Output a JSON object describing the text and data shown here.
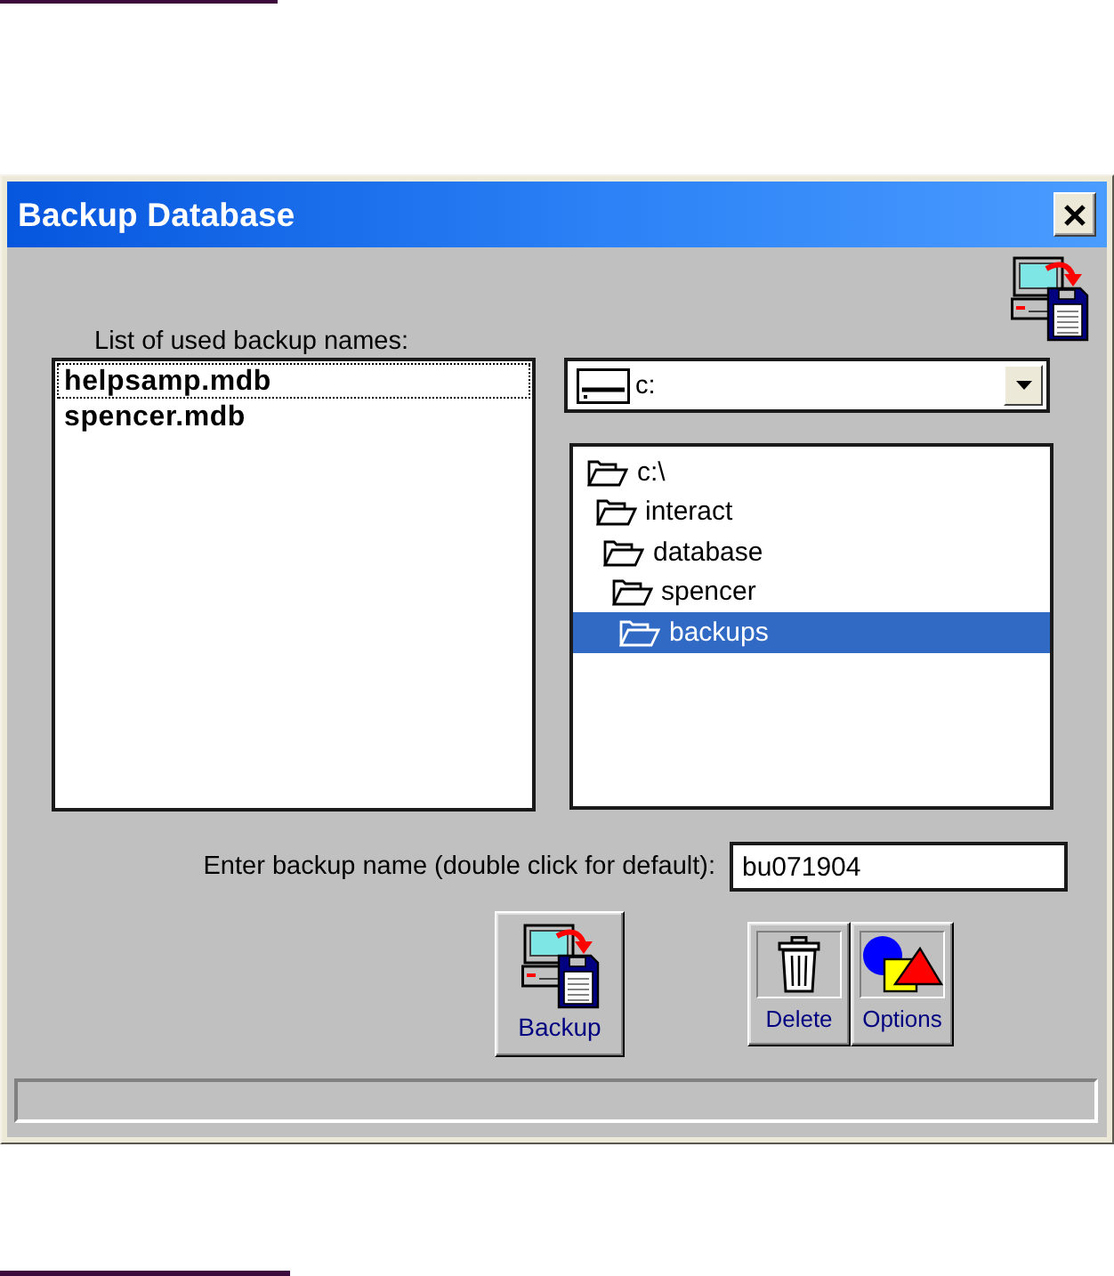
{
  "dialog": {
    "title": "Backup Database"
  },
  "used_names": {
    "label": "List of used backup names:",
    "items": [
      {
        "name": "helpsamp.mdb",
        "focused": true
      },
      {
        "name": "spencer.mdb",
        "focused": false
      }
    ]
  },
  "drive": {
    "value": "c:"
  },
  "folders": [
    {
      "name": "c:\\",
      "selected": false,
      "children": [
        {
          "name": "interact",
          "selected": false,
          "children": [
            {
              "name": "database",
              "selected": false,
              "children": [
                {
                  "name": "spencer",
                  "selected": false,
                  "children": [
                    {
                      "name": "backups",
                      "selected": true
                    }
                  ]
                }
              ]
            }
          ]
        }
      ]
    }
  ],
  "backup_name": {
    "label": "Enter backup name (double click for default):",
    "value": "bu071904"
  },
  "buttons": [
    {
      "kind": "backup",
      "label": "Backup"
    },
    {
      "kind": "delete",
      "label": "Delete"
    },
    {
      "kind": "options",
      "label": "Options"
    }
  ]
}
